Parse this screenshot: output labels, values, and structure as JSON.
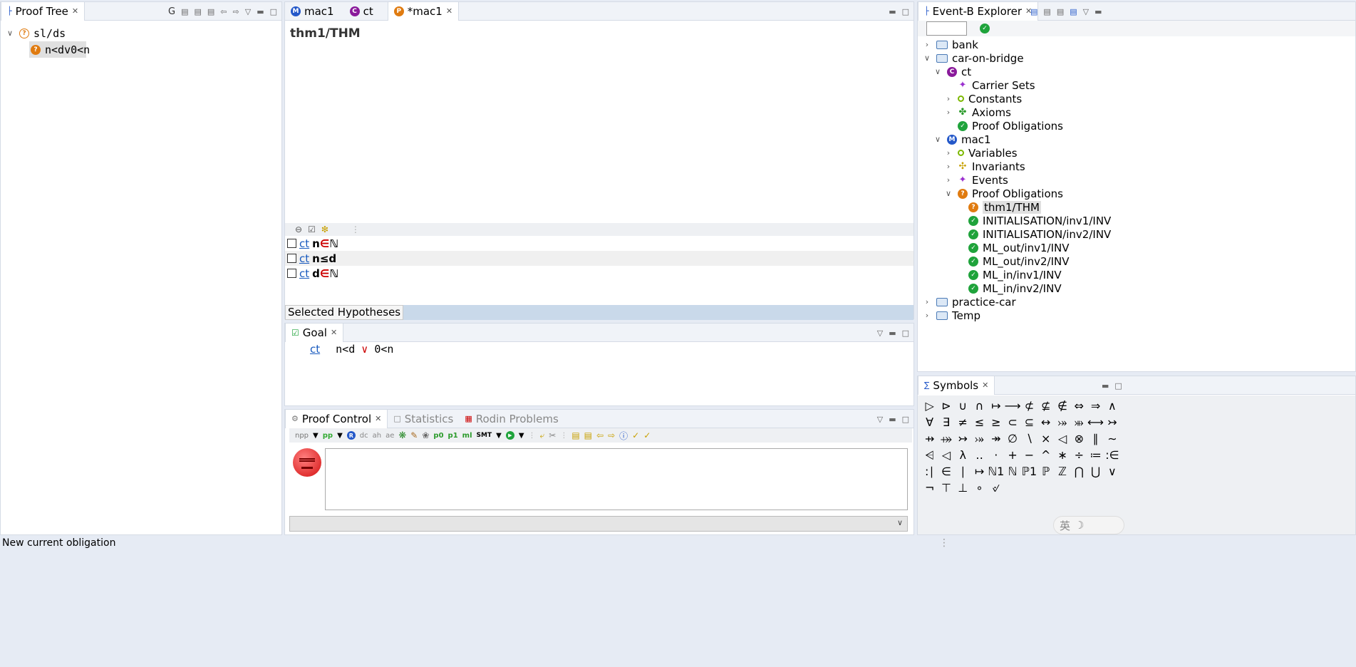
{
  "proof_tree": {
    "title": "Proof Tree",
    "toolbar_letter": "G",
    "root": "sl/ds",
    "node": "n<dv0<n"
  },
  "editor": {
    "tabs": [
      "mac1",
      "ct",
      "*mac1"
    ],
    "heading": "thm1/THM",
    "hyp_toolbar": [
      "⊖",
      "☑",
      "❇"
    ],
    "hypotheses": [
      {
        "src": "ct",
        "pre": "n",
        "op": "∈",
        "post": "ℕ"
      },
      {
        "src": "ct",
        "pre": "n",
        "op": "≤",
        "post": "d"
      },
      {
        "src": "ct",
        "pre": "d",
        "op": "∈",
        "post": "ℕ"
      }
    ],
    "selected_label": "Selected Hypotheses"
  },
  "goal": {
    "title": "Goal",
    "src": "ct",
    "expr_left": "n<d",
    "op": "∨",
    "expr_right": "0<n"
  },
  "proof_control": {
    "tabs": [
      "Proof Control",
      "Statistics",
      "Rodin Problems"
    ],
    "toolbar": [
      "npp",
      "pp",
      "R",
      "dc",
      "ah",
      "ae",
      "p0",
      "p1",
      "ml",
      "SMT"
    ]
  },
  "explorer": {
    "title": "Event-B Explorer",
    "items": [
      {
        "label": "bank",
        "level": 0,
        "chev": ">",
        "icon": "folder"
      },
      {
        "label": "car-on-bridge",
        "level": 0,
        "chev": "v",
        "icon": "folder"
      },
      {
        "label": "ct",
        "level": 1,
        "chev": "v",
        "icon": "c"
      },
      {
        "label": "Carrier Sets",
        "level": 2,
        "chev": "",
        "icon": "star"
      },
      {
        "label": "Constants",
        "level": 2,
        "chev": ">",
        "icon": "dot"
      },
      {
        "label": "Axioms",
        "level": 2,
        "chev": ">",
        "icon": "axiom"
      },
      {
        "label": "Proof Obligations",
        "level": 2,
        "chev": "",
        "icon": "ok"
      },
      {
        "label": "mac1",
        "level": 1,
        "chev": "v",
        "icon": "m"
      },
      {
        "label": "Variables",
        "level": 2,
        "chev": ">",
        "icon": "dot"
      },
      {
        "label": "Invariants",
        "level": 2,
        "chev": ">",
        "icon": "inv"
      },
      {
        "label": "Events",
        "level": 2,
        "chev": ">",
        "icon": "star"
      },
      {
        "label": "Proof Obligations",
        "level": 2,
        "chev": "v",
        "icon": "p"
      },
      {
        "label": "thm1/THM",
        "level": 3,
        "chev": "",
        "icon": "pq",
        "selected": true
      },
      {
        "label": "INITIALISATION/inv1/INV",
        "level": 3,
        "chev": "",
        "icon": "ok"
      },
      {
        "label": "INITIALISATION/inv2/INV",
        "level": 3,
        "chev": "",
        "icon": "ok"
      },
      {
        "label": "ML_out/inv1/INV",
        "level": 3,
        "chev": "",
        "icon": "ok"
      },
      {
        "label": "ML_out/inv2/INV",
        "level": 3,
        "chev": "",
        "icon": "ok"
      },
      {
        "label": "ML_in/inv1/INV",
        "level": 3,
        "chev": "",
        "icon": "ok"
      },
      {
        "label": "ML_in/inv2/INV",
        "level": 3,
        "chev": "",
        "icon": "ok"
      },
      {
        "label": "practice-car",
        "level": 0,
        "chev": ">",
        "icon": "folder"
      },
      {
        "label": "Temp",
        "level": 0,
        "chev": ">",
        "icon": "folder"
      }
    ]
  },
  "symbols": {
    "title": "Symbols",
    "rows": [
      [
        "▷",
        "⊳",
        "∪",
        "∩",
        "↦",
        "⟶",
        "⊄",
        "⊈",
        "∉",
        "⇔",
        "⇒",
        "∧"
      ],
      [
        "∀",
        "∃",
        "≠",
        "≤",
        "≥",
        "⊂",
        "⊆",
        "↔",
        "⤖",
        "⤕",
        "⟷",
        "↣"
      ],
      [
        "⇸",
        "⤀",
        "↣",
        "⤖",
        "↠",
        "∅",
        "∖",
        "×",
        "◁",
        "⊗",
        "∥",
        "∼"
      ],
      [
        "⩤",
        "◁",
        "λ",
        "‥",
        "·",
        "+",
        "−",
        "^",
        "∗",
        "÷",
        "≔",
        ":∈"
      ],
      [
        ":∣",
        "∈",
        "∣",
        "↦",
        "ℕ1",
        "ℕ",
        "ℙ1",
        "ℙ",
        "ℤ",
        "⋂",
        "⋃",
        "∨"
      ],
      [
        "¬",
        "⊤",
        "⊥",
        "∘",
        "୰"
      ]
    ]
  },
  "status": {
    "text": "New current obligation"
  },
  "ime": {
    "text": "英"
  }
}
